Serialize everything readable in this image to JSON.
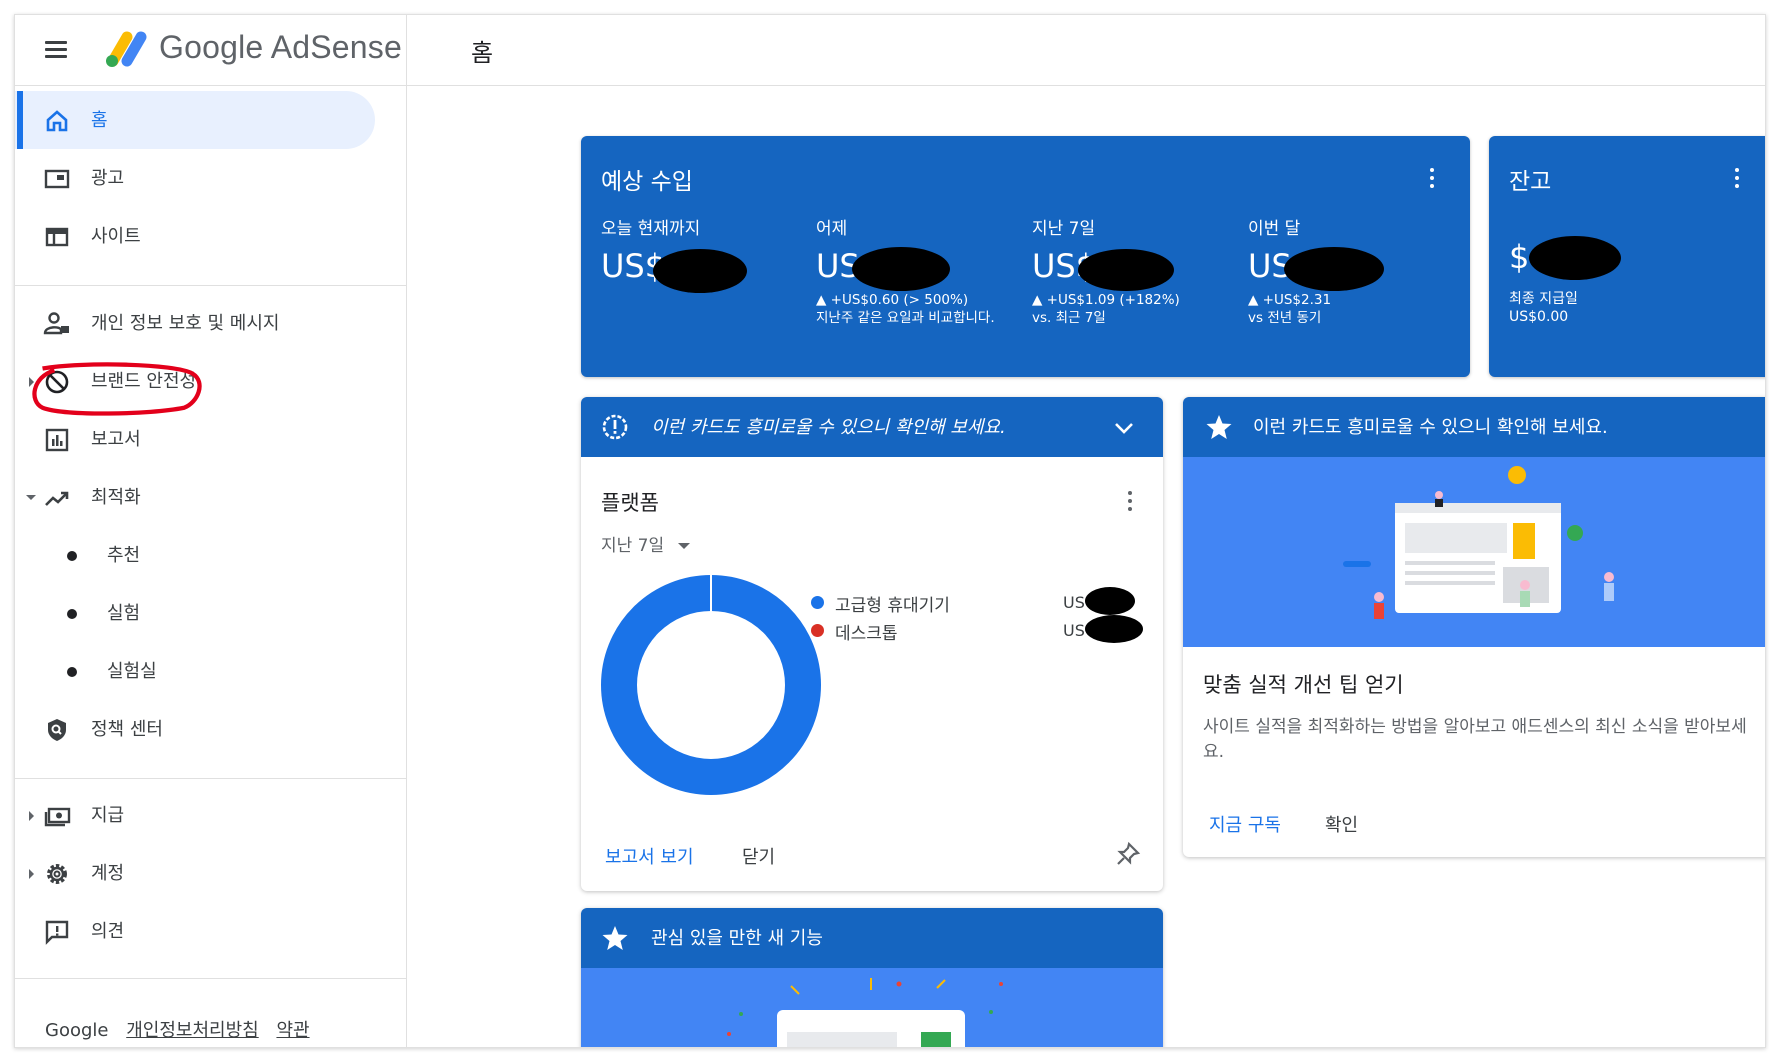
{
  "header": {
    "brand": "Google AdSense",
    "page_title": "홈"
  },
  "sidebar": {
    "items": [
      {
        "label": "홈",
        "icon": "home-icon",
        "active": true
      },
      {
        "label": "광고",
        "icon": "ads-icon"
      },
      {
        "label": "사이트",
        "icon": "sites-icon"
      },
      {
        "label": "개인 정보 보호 및 메시지",
        "icon": "privacy-icon"
      },
      {
        "label": "브랜드 안전성",
        "icon": "block-icon"
      },
      {
        "label": "보고서",
        "icon": "reports-icon"
      },
      {
        "label": "최적화",
        "icon": "trending-icon"
      },
      {
        "label": "추천"
      },
      {
        "label": "실험"
      },
      {
        "label": "실험실"
      },
      {
        "label": "정책 센터",
        "icon": "policy-shield-icon"
      },
      {
        "label": "지급",
        "icon": "payments-icon"
      },
      {
        "label": "계정",
        "icon": "gear-icon"
      },
      {
        "label": "의견",
        "icon": "feedback-icon"
      }
    ],
    "footer": {
      "google": "Google",
      "privacy": "개인정보처리방침",
      "terms": "약관"
    }
  },
  "earnings": {
    "title": "예상 수입",
    "metrics": [
      {
        "label": "오늘 현재까지",
        "value": "US$",
        "change": ""
      },
      {
        "label": "어제",
        "value": "US",
        "change": "▲ +US$0.60 (> 500%)\n지난주 같은 요일과 비교합니다."
      },
      {
        "label": "지난 7일",
        "value": "US$",
        "change": "▲ +US$1.09 (+182%)\nvs. 최근 7일"
      },
      {
        "label": "이번 달",
        "value": "US",
        "change": "▲ +US$2.31\nvs 전년 동기"
      }
    ]
  },
  "balance": {
    "title": "잔고",
    "value": "$",
    "last_payment_label": "최종 지급일",
    "last_payment_value": "US$0.00"
  },
  "platform_card": {
    "header_text": "이런 카드도 흥미로울 수 있으니 확인해 보세요.",
    "title": "플랫폼",
    "range": "지난 7일",
    "legend": [
      {
        "name": "고급형 휴대기기",
        "value": "US",
        "color": "#1a73e8"
      },
      {
        "name": "데스크톱",
        "value": "US",
        "color": "#d93025"
      }
    ],
    "donut": {
      "mobile_fraction": 0.9,
      "desktop_fraction": 0.1
    },
    "view_report": "보고서 보기",
    "close": "닫기"
  },
  "tips_card": {
    "header_text": "이런 카드도 흥미로울 수 있으니 확인해 보세요.",
    "title": "맞춤 실적 개선 팁 얻기",
    "body": "사이트 실적을 최적화하는 방법을 알아보고 애드센스의 최신 소식을 받아보세요.",
    "subscribe": "지금 구독",
    "confirm": "확인"
  },
  "features_card": {
    "header_text": "관심 있을 만한 새 기능"
  },
  "colors": {
    "accent": "#1a73e8",
    "card_blue": "#1565c0",
    "desktop_red": "#d93025"
  }
}
